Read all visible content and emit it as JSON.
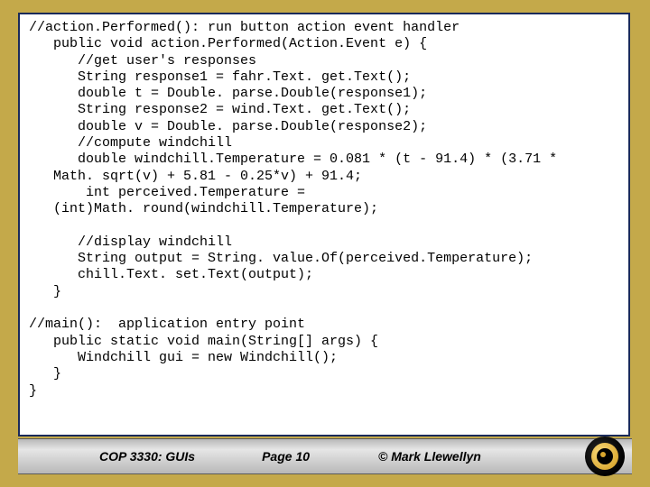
{
  "code": {
    "lines": [
      "//action.Performed(): run button action event handler",
      "   public void action.Performed(Action.Event e) {",
      "      //get user's responses",
      "      String response1 = fahr.Text. get.Text();",
      "      double t = Double. parse.Double(response1);",
      "      String response2 = wind.Text. get.Text();",
      "      double v = Double. parse.Double(response2);",
      "      //compute windchill",
      "      double windchill.Temperature = 0.081 * (t - 91.4) * (3.71 *",
      "   Math. sqrt(v) + 5.81 - 0.25*v) + 91.4;",
      "       int perceived.Temperature =",
      "   (int)Math. round(windchill.Temperature);",
      "",
      "      //display windchill",
      "      String output = String. value.Of(perceived.Temperature);",
      "      chill.Text. set.Text(output);",
      "   }",
      "",
      "//main():  application entry point",
      "   public static void main(String[] args) {",
      "      Windchill gui = new Windchill();",
      "   }",
      "}"
    ]
  },
  "footer": {
    "course": "COP 3330: GUIs",
    "page": "Page 10",
    "copyright": "© Mark Llewellyn"
  }
}
